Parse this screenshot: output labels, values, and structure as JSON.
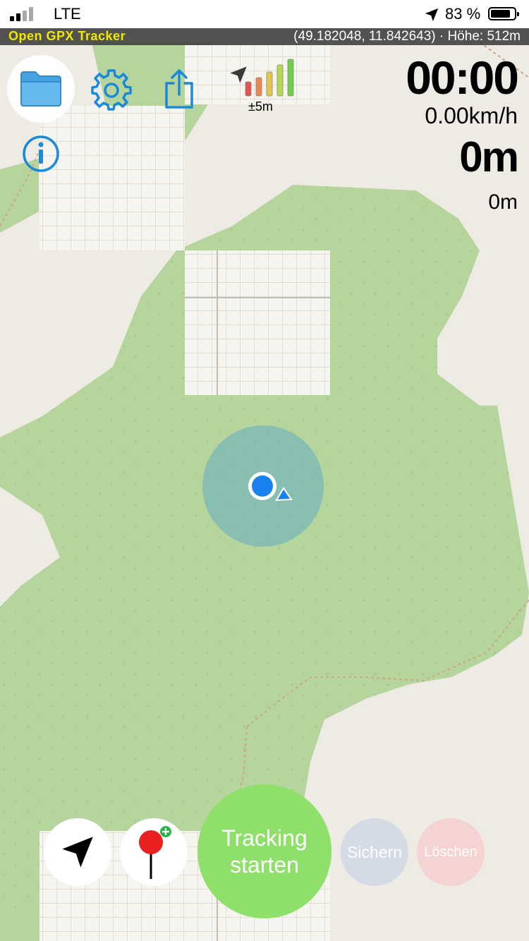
{
  "status_bar": {
    "carrier": "LTE",
    "battery_percent": "83 %"
  },
  "app_bar": {
    "title": "Open GPX Tracker",
    "coordinates": "(49.182048, 11.842643) · Höhe: 512m"
  },
  "toolbar": {
    "icons": [
      "folder-icon",
      "gear-icon",
      "share-icon",
      "info-icon"
    ],
    "gps_accuracy": "±5m",
    "signal_bar_colors": [
      "#e7514b",
      "#f1844b",
      "#e6c64a",
      "#b6d84a",
      "#6fcf4a"
    ]
  },
  "stats": {
    "time": "00:00",
    "speed": "0.00km/h",
    "distance": "0m",
    "segment_distance": "0m"
  },
  "controls": {
    "track_button": "Tracking starten",
    "save_button": "Sichern",
    "delete_button": "Löschen"
  },
  "colors": {
    "forest": "#b5d59c",
    "map_bg": "#eeebe5",
    "track_button": "#8fe06a",
    "accent_blue": "#1a8ad8",
    "location_dot": "#1a82f0"
  }
}
